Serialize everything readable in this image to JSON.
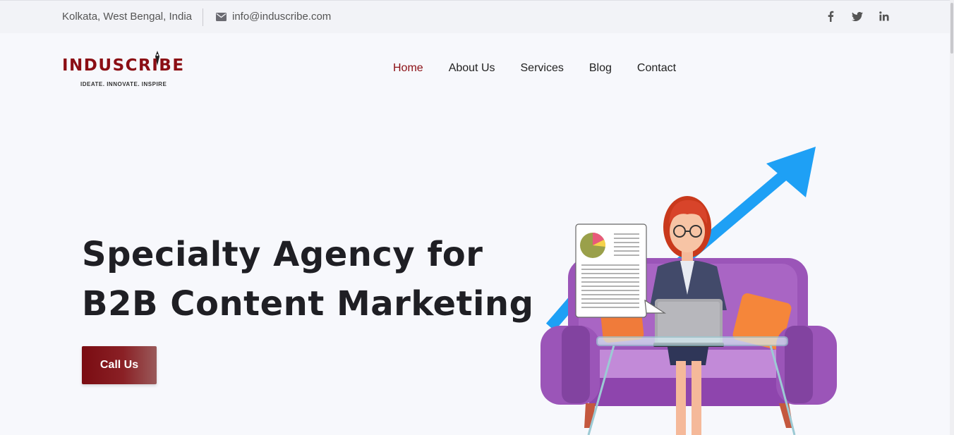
{
  "topbar": {
    "location": "Kolkata, West Bengal, India",
    "email": "info@induscribe.com",
    "social": [
      "facebook-icon",
      "twitter-icon",
      "linkedin-icon"
    ]
  },
  "logo": {
    "name": "INDUSCRIBE",
    "tagline": "IDEATE. INNOVATE. INSPIRE"
  },
  "nav": {
    "items": [
      {
        "label": "Home",
        "active": true
      },
      {
        "label": "About Us",
        "active": false
      },
      {
        "label": "Services",
        "active": false
      },
      {
        "label": "Blog",
        "active": false
      },
      {
        "label": "Contact",
        "active": false
      }
    ]
  },
  "hero": {
    "title_line1": "Specialty Agency for",
    "title_line2": "B2B Content Marketing",
    "cta_label": "Call Us"
  },
  "colors": {
    "brand": "#8b0e14",
    "arrow": "#1ea0f5",
    "sofa": "#9b55b8"
  }
}
